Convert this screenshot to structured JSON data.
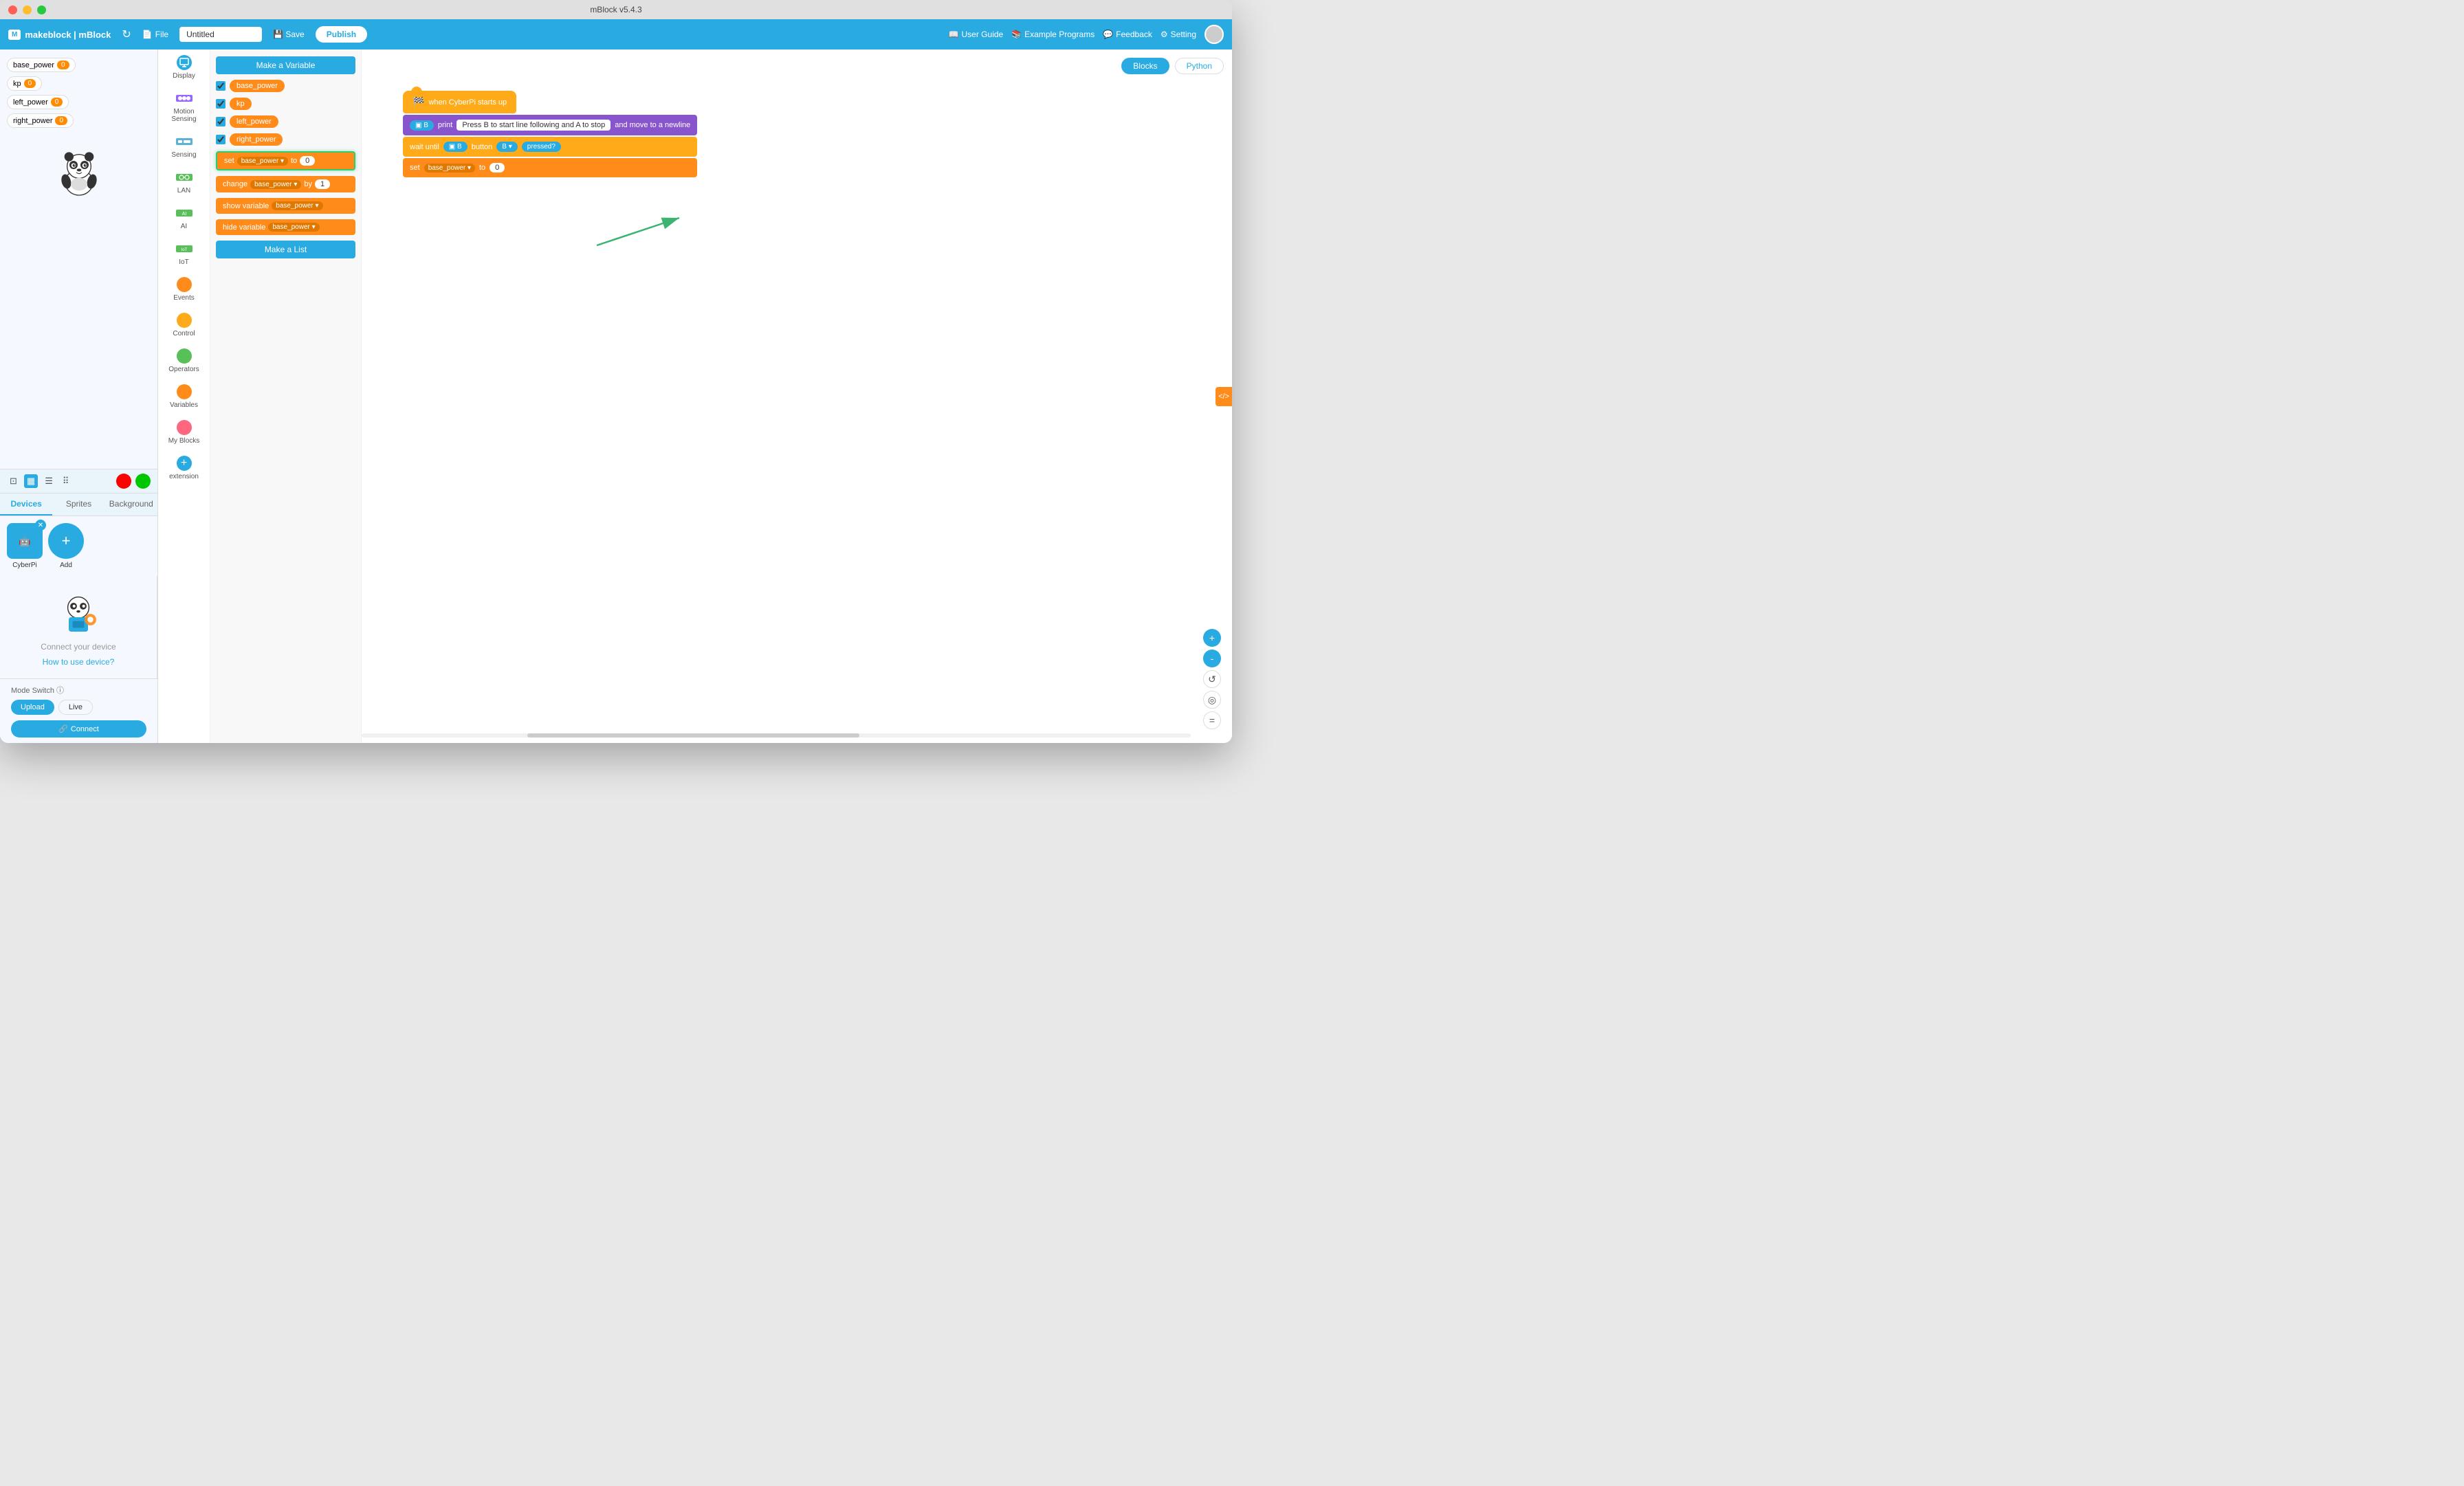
{
  "window": {
    "title": "mBlock v5.4.3"
  },
  "toolbar": {
    "brand": "makeblock | mBlock",
    "file_label": "File",
    "title_value": "Untitled",
    "save_label": "Save",
    "publish_label": "Publish",
    "user_guide_label": "User Guide",
    "example_programs_label": "Example Programs",
    "feedback_label": "Feedback",
    "setting_label": "Setting"
  },
  "variables": [
    {
      "name": "base_power",
      "value": "0"
    },
    {
      "name": "kp",
      "value": "0"
    },
    {
      "name": "left_power",
      "value": "0"
    },
    {
      "name": "right_power",
      "value": "0"
    }
  ],
  "view_controls": {
    "stop_label": "stop",
    "go_label": "go"
  },
  "tabs": {
    "devices": "Devices",
    "sprites": "Sprites",
    "background": "Background"
  },
  "device": {
    "name": "CyberPi",
    "connect_text": "Connect your device",
    "how_to_link": "How to use device?",
    "mode_switch_label": "Mode Switch",
    "upload_label": "Upload",
    "live_label": "Live",
    "connect_btn_label": "Connect"
  },
  "categories": [
    {
      "id": "display",
      "label": "Display",
      "color": "blue",
      "icon": "grid"
    },
    {
      "id": "motion-sensing",
      "label": "Motion Sensing",
      "color": "purple",
      "icon": "arrows"
    },
    {
      "id": "sensing",
      "label": "Sensing",
      "color": "cyan",
      "icon": "eye"
    },
    {
      "id": "lan",
      "label": "LAN",
      "color": "green",
      "icon": "network"
    },
    {
      "id": "ai",
      "label": "AI",
      "color": "green",
      "icon": "brain"
    },
    {
      "id": "iot",
      "label": "IoT",
      "color": "green",
      "icon": "iot"
    },
    {
      "id": "events",
      "label": "Events",
      "color": "orange",
      "icon": "bolt"
    },
    {
      "id": "control",
      "label": "Control",
      "color": "orange",
      "icon": "control"
    },
    {
      "id": "operators",
      "label": "Operators",
      "color": "green",
      "icon": "operators"
    },
    {
      "id": "variables",
      "label": "Variables",
      "color": "orange",
      "icon": "variables"
    },
    {
      "id": "my-blocks",
      "label": "My Blocks",
      "color": "red",
      "icon": "blocks"
    },
    {
      "id": "extension",
      "label": "extension",
      "color": "blue",
      "icon": "plus"
    }
  ],
  "blocks_panel": {
    "make_variable_label": "Make a Variable",
    "make_list_label": "Make a List",
    "variables": [
      "base_power",
      "kp",
      "left_power",
      "right_power"
    ],
    "set_block": {
      "label": "set",
      "var": "base_power",
      "value": "0"
    },
    "change_block": {
      "label": "change",
      "var": "base_power",
      "by": "1"
    },
    "show_block": {
      "label": "show variable",
      "var": "base_power"
    },
    "hide_block": {
      "label": "hide variable",
      "var": "base_power"
    }
  },
  "canvas": {
    "blocks_tab": "Blocks",
    "python_tab": "Python",
    "code_blocks": {
      "when_block": "when CyberPi starts up",
      "print_block_pre": "print",
      "print_text": "Press B to start line following and A to stop",
      "print_block_post": "and move to a newline",
      "wait_block": "wait until",
      "wait_button": "B",
      "wait_pressed": "pressed?",
      "set_label": "set",
      "set_var": "base_power",
      "set_to": "to",
      "set_value": "0"
    }
  },
  "zoom": {
    "zoom_in": "+",
    "zoom_out": "-",
    "reset": "⟳"
  }
}
